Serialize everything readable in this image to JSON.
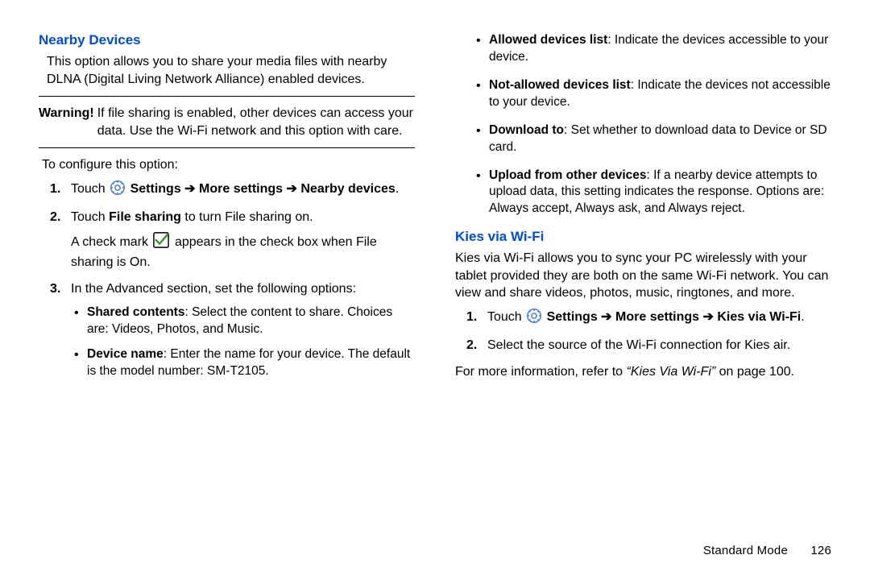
{
  "left": {
    "heading": "Nearby Devices",
    "intro": "This option allows you to share your media files with nearby DLNA (Digital Living Network Alliance) enabled devices.",
    "warning_label": "Warning!",
    "warning_body": "If file sharing is enabled, other devices can access your data. Use the Wi-Fi network and this option with care.",
    "configure": "To configure this option:",
    "step1_prefix": "Touch ",
    "settings_word": "Settings",
    "arrow": "➔",
    "more_settings": "More settings",
    "nearby_devices": "Nearby devices",
    "step2_a": "Touch ",
    "step2_bold": "File sharing",
    "step2_b": " to turn File sharing on.",
    "step2_c1": "A check mark ",
    "step2_c2": " appears in the check box when File sharing is On.",
    "step3": "In the Advanced section, set the following options:",
    "step3_b1_label": "Shared contents",
    "step3_b1_body": ": Select the content to share. Choices are: Videos, Photos, and Music.",
    "step3_b2_label": "Device name",
    "step3_b2_body": ": Enter the name for your device. The default is the model number: SM-T2105."
  },
  "right": {
    "b1_label": "Allowed devices list",
    "b1_body": ": Indicate the devices accessible to your device.",
    "b2_label": "Not-allowed devices list",
    "b2_body": ": Indicate the devices not accessible to your device.",
    "b3_label": "Download to",
    "b3_body": ": Set whether to download data to Device or SD card.",
    "b4_label": "Upload from other devices",
    "b4_body": ": If a nearby device attempts to upload data, this setting indicates the response. Options are: Always accept, Always ask, and Always reject.",
    "heading2": "Kies via Wi-Fi",
    "k_intro": "Kies via Wi-Fi allows you to sync your PC wirelessly with your tablet provided they are both on the same Wi-Fi network. You can view and share videos, photos, music, ringtones, and more.",
    "k_step1_prefix": "Touch ",
    "k_settings": "Settings",
    "k_arrow": "➔",
    "k_more": "More settings",
    "k_kies": "Kies via Wi-Fi",
    "k_step2": "Select the source of the Wi-Fi connection for Kies air.",
    "k_more_info_a": "For more information, refer to ",
    "k_more_info_ref": "“Kies Via Wi-Fi”",
    "k_more_info_b": " on page 100."
  },
  "footer": {
    "mode": "Standard Mode",
    "page": "126"
  }
}
